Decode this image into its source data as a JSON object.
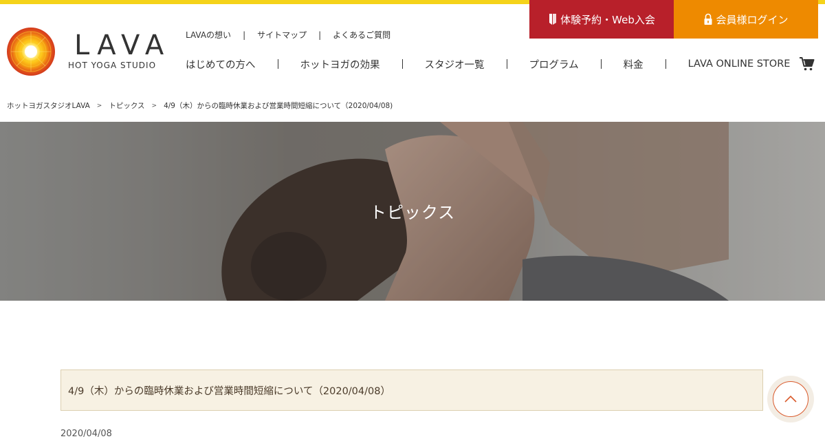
{
  "brand": {
    "name": "LAVA",
    "tagline": "HOT YOGA STUDIO"
  },
  "cta": {
    "trial": "体験予約・Web入会",
    "login": "会員様ログイン"
  },
  "subnav": [
    "LAVAの想い",
    "サイトマップ",
    "よくあるご質問"
  ],
  "subnav_separator": "|",
  "mainnav": [
    "はじめての方へ",
    "ホットヨガの効果",
    "スタジオ一覧",
    "プログラム",
    "料金",
    "LAVA ONLINE STORE"
  ],
  "breadcrumb": {
    "home": "ホットヨガスタジオLAVA",
    "section": "トピックス",
    "current": "4/9（木）からの臨時休業および営業時間短縮について（2020/04/08)",
    "separator": ">"
  },
  "hero": {
    "title": "トピックス"
  },
  "article": {
    "title": "4/9（木）からの臨時休業および営業時間短縮について（2020/04/08）",
    "date": "2020/04/08"
  },
  "icons": {
    "cta_trial": "bookmark-icon",
    "cta_login": "lock-icon",
    "store": "cart-icon",
    "back_to_top": "chevron-up-icon"
  },
  "colors": {
    "accent_yellow": "#f5d31a",
    "trial_red": "#b8202a",
    "login_orange": "#ee8a00",
    "article_bg": "#f7f1e3",
    "totop_ring": "#d9592a"
  }
}
